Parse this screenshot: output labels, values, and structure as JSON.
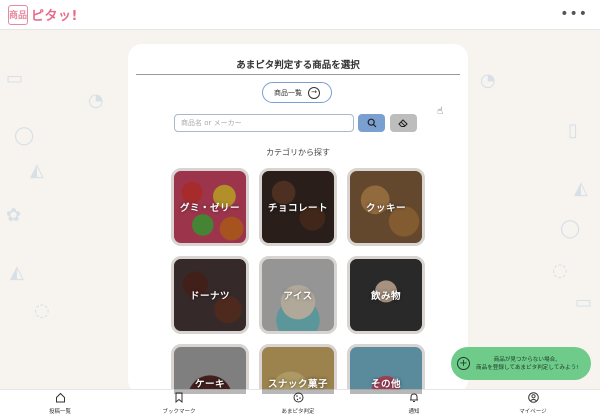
{
  "header": {
    "logo_mark": "商品",
    "logo_text": "ピタッ!",
    "menu_icon": "more-dots-icon"
  },
  "panel": {
    "title": "あまピタ判定する商品を選択",
    "list_button_label": "商品一覧",
    "search": {
      "placeholder": "商品名 or メーカー",
      "value": ""
    },
    "category_heading": "カテゴリから探す",
    "categories": [
      {
        "label": "グミ・ゼリー"
      },
      {
        "label": "チョコレート"
      },
      {
        "label": "クッキー"
      },
      {
        "label": "ドーナツ"
      },
      {
        "label": "アイス"
      },
      {
        "label": "飲み物"
      },
      {
        "label": "ケーキ"
      },
      {
        "label": "スナック菓子"
      },
      {
        "label": "その他"
      }
    ]
  },
  "fab": {
    "line1": "商品が見つからない場合、",
    "line2": "商品を登録してあまピタ判定してみよう!"
  },
  "bottom_nav": [
    {
      "label": "投稿一覧",
      "icon": "home-icon"
    },
    {
      "label": "ブックマーク",
      "icon": "bookmark-icon"
    },
    {
      "label": "あまピタ判定",
      "icon": "cookie-icon"
    },
    {
      "label": "通知",
      "icon": "bell-icon"
    },
    {
      "label": "マイページ",
      "icon": "user-icon"
    }
  ],
  "colors": {
    "brand_pink": "#e86a8c",
    "accent_blue": "#7a9fd1",
    "fab_green": "#6ecb8a",
    "background": "#f7f3ee"
  }
}
